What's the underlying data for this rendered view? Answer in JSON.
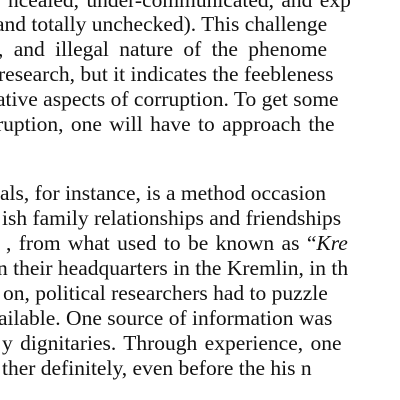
{
  "document": {
    "paragraph_1": [
      "ncealed, under-communicated, and exp",
      "and totally unchecked). This challenge",
      ", and illegal nature of the phenome",
      "research, but it indicates the feebleness",
      "ative aspects of corruption. To get some",
      "ruption, one will have to approach the"
    ],
    "paragraph_2": {
      "line_1": "als, for instance, is a method occasion",
      "line_2": "ish family relationships and friendships",
      "line_3_start": ", from what used to be known as “",
      "line_3_italic": "Kre",
      "line_4": "n their headquarters in the Kremlin, in th",
      "line_5": "on, political researchers had to puzzle",
      "line_6": "ailable. One source of information was",
      "line_7": "y dignitaries. Through experience, one",
      "line_8": "ther definitely, even before the his n"
    }
  }
}
